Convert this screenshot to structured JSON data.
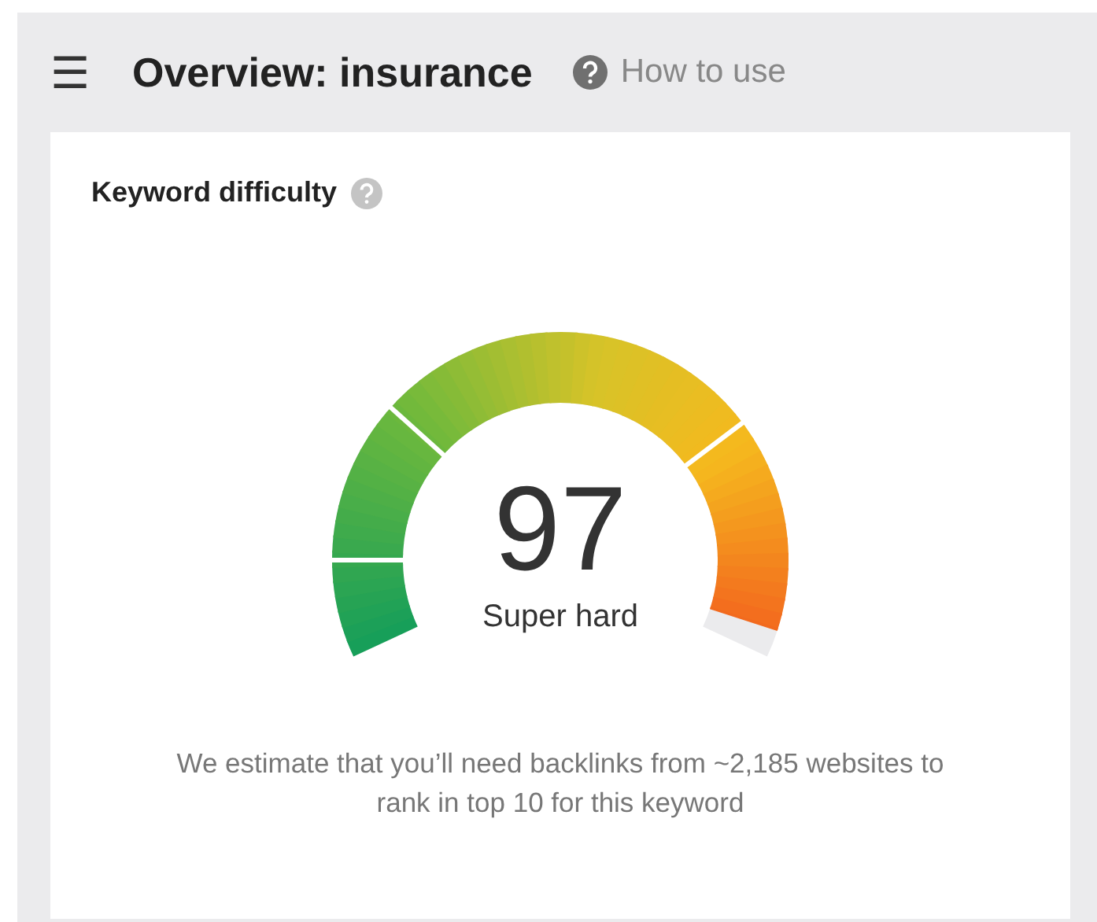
{
  "header": {
    "menu_icon": "☰",
    "title": "Overview: insurance",
    "help_link": "How to use"
  },
  "card": {
    "title": "Keyword difficulty",
    "difficulty": {
      "value": "97",
      "label": "Super hard",
      "level": 0.97
    },
    "description": "We estimate that you’ll need backlinks from ~2,185 websites to rank in top 10 for this keyword"
  }
}
